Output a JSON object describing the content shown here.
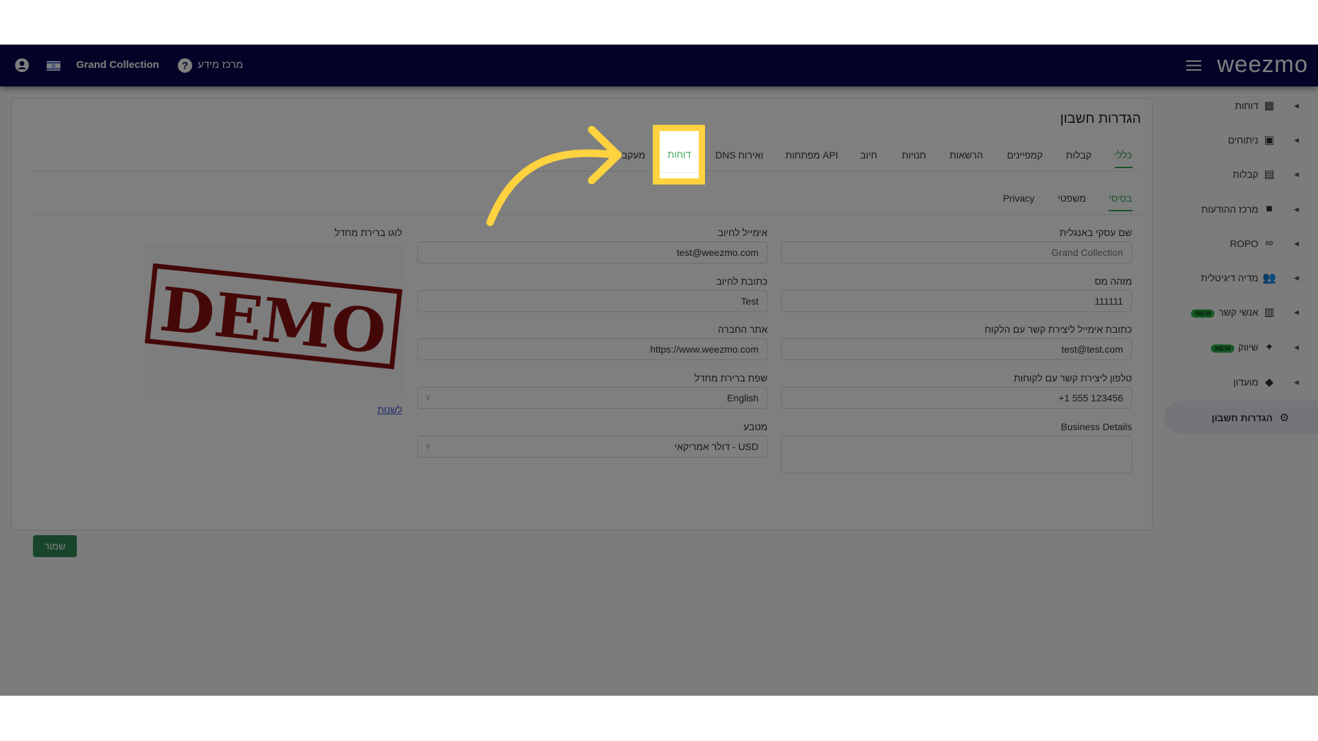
{
  "header": {
    "store_name": "Grand Collection",
    "help_label": "מרכז מידע",
    "logo": "weezmo",
    "icons": [
      "user-icon",
      "flag-icon",
      "help-icon",
      "menu-icon"
    ]
  },
  "page": {
    "title": "הגדרות חשבון",
    "tabs": [
      "כללי",
      "קבלות",
      "קמפיינים",
      "הרשאות",
      "חנויות",
      "חיוב",
      "מפתחות API",
      "DNS ואירוח",
      "דוחות",
      "מעקב"
    ],
    "active_tab": "כללי",
    "highlighted_tab": "דוחות",
    "subtabs": [
      "בסיסי",
      "משפטי",
      "Privacy"
    ],
    "active_subtab": "בסיסי"
  },
  "form": {
    "business_name_en": {
      "label": "שם עסקי באנגלית",
      "placeholder": "Grand Collection"
    },
    "tax_id": {
      "label": "מזהה מס",
      "value": "111111"
    },
    "contact_email": {
      "label": "כתובת אימייל ליצירת קשר עם הלקוח",
      "value": "test@test.com"
    },
    "contact_phone": {
      "label": "טלפון ליצירת קשר עם לקוחות",
      "value": "+1 555 123456"
    },
    "business_details": {
      "label": "Business Details",
      "value": ""
    },
    "billing_email": {
      "label": "אימייל לחיוב",
      "value": "test@weezmo.com"
    },
    "billing_address": {
      "label": "כתובת לחיוב",
      "value": "Test"
    },
    "website": {
      "label": "אתר החברה",
      "value": "https://www.weezmo.com"
    },
    "default_language": {
      "label": "שפת ברירת מחדל",
      "value": "English"
    },
    "currency": {
      "label": "מטבע",
      "value": "USD - דולר אמריקאי"
    },
    "logo": {
      "label": "לוגו ברירת מחדל",
      "image_text": "DEMO",
      "change_link": "לשנות"
    },
    "save_label": "שמור"
  },
  "sidebar": {
    "items": [
      {
        "label": "דוחות",
        "icon": "dashboard-icon"
      },
      {
        "label": "ניתוחים",
        "icon": "analytics-icon"
      },
      {
        "label": "קבלות",
        "icon": "receipt-icon"
      },
      {
        "label": "מרכז ההודעות",
        "icon": "message-icon"
      },
      {
        "label": "ROPO",
        "icon": "infinity-icon"
      },
      {
        "label": "מדיה דיגיטלית",
        "icon": "people-icon"
      },
      {
        "label": "אנשי קשר",
        "icon": "contacts-icon",
        "badge": "NEW!"
      },
      {
        "label": "שיווק",
        "icon": "party-popper-icon",
        "badge": "NEW!"
      },
      {
        "label": "מועדון",
        "icon": "tag-icon"
      },
      {
        "label": "הגדרות חשבון",
        "icon": "gear-icon",
        "active": true
      }
    ]
  },
  "colors": {
    "nav": "#06064f",
    "accent": "#3aa655",
    "highlight": "#ffd23f",
    "save_button": "#2e8b57",
    "link": "#3b5bdb"
  }
}
